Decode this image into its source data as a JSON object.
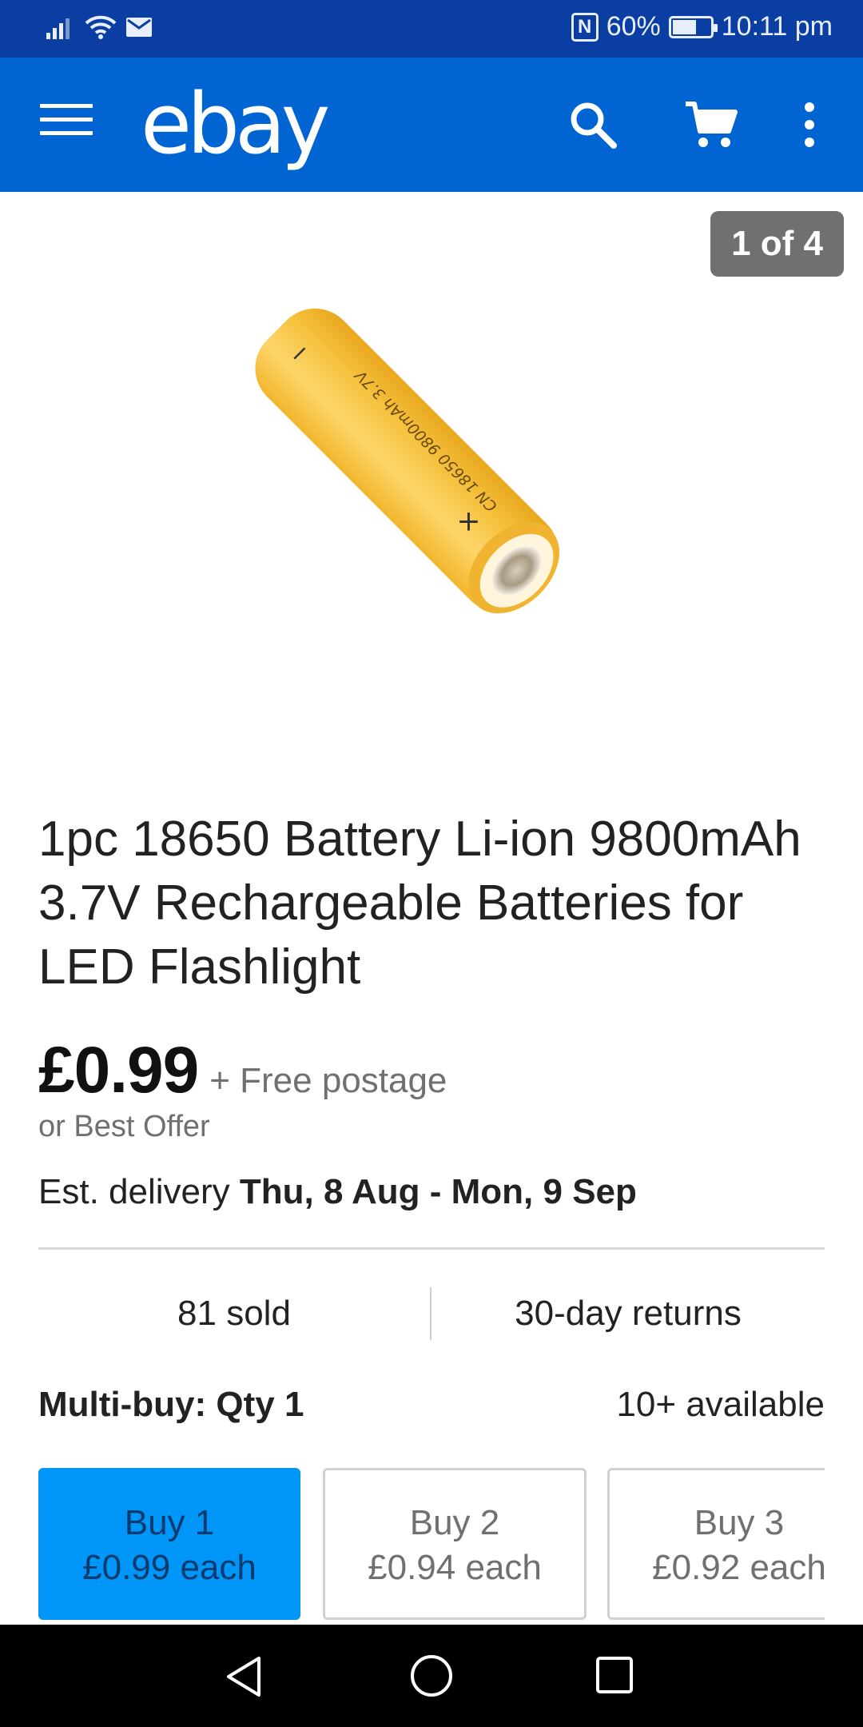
{
  "status_bar": {
    "nfc_label": "N",
    "battery_percent": "60%",
    "battery_level": 0.6,
    "time": "10:11 pm",
    "icons": [
      "signal-icon",
      "wifi-icon",
      "mail-icon",
      "nfc-icon",
      "battery-icon"
    ]
  },
  "app_bar": {
    "logo": "ebay",
    "icons": [
      "menu-icon",
      "search-icon",
      "cart-icon",
      "more-vert-icon"
    ],
    "color": "#0064d2"
  },
  "gallery": {
    "counter": "1 of 4",
    "battery_label_text": "CN 18650 9800mAh 3.7V"
  },
  "listing": {
    "title": "1pc 18650 Battery Li-ion 9800mAh 3.7V Rechargeable Batteries for LED Flashlight",
    "price": "£0.99",
    "postage": "+ Free postage",
    "best_offer": "or Best Offer",
    "delivery_label": "Est. delivery ",
    "delivery_dates": "Thu, 8 Aug - Mon, 9 Sep",
    "sold": "81 sold",
    "returns": "30-day returns",
    "multibuy": "Multi-buy: Qty 1",
    "available": "10+ available",
    "options": [
      {
        "line1": "Buy 1",
        "line2": "£0.99 each"
      },
      {
        "line1": "Buy 2",
        "line2": "£0.94 each"
      },
      {
        "line1": "Buy 3",
        "line2": "£0.92 each"
      }
    ],
    "selected_color": "#0096f7"
  },
  "nav_bar": {
    "icons": [
      "back-icon",
      "home-icon",
      "recents-icon"
    ]
  }
}
